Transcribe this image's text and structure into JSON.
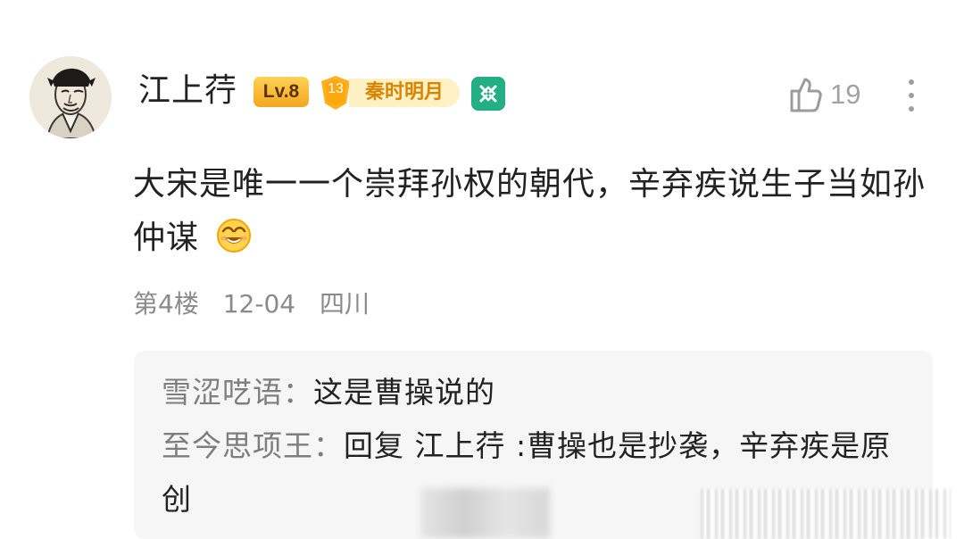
{
  "comment": {
    "user": {
      "name": "江上荇",
      "level": "Lv.8",
      "member_level": "13",
      "member_title": "秦时明月",
      "avatar": "scholar-portrait-icon",
      "badge": "green-badge-icon"
    },
    "actions": {
      "like_icon": "thumbs-up-icon",
      "like_count": "19",
      "more_icon": "vertical-dots-icon"
    },
    "content": {
      "text": "大宋是唯一一个崇拜孙权的朝代，辛弃疾说生子当如孙仲谋",
      "emoji": "laughing-emoji"
    },
    "meta": {
      "floor": "第4楼",
      "date": "12-04",
      "location": "四川"
    }
  },
  "replies": [
    {
      "author": "雪涩呓语：",
      "text": "这是曹操说的"
    },
    {
      "author": "至今思项王：",
      "reply_prefix": "回复",
      "reply_to": "江上荇",
      "text": ":曹操也是抄袭，辛弃疾是原创"
    }
  ],
  "colors": {
    "level_badge": "#f3a61e",
    "member_badge": "#fff1c4",
    "member_text": "#d78500",
    "green_badge": "#23ae84",
    "secondary_text": "#8a8a8a",
    "reply_background": "#f6f6f6"
  }
}
